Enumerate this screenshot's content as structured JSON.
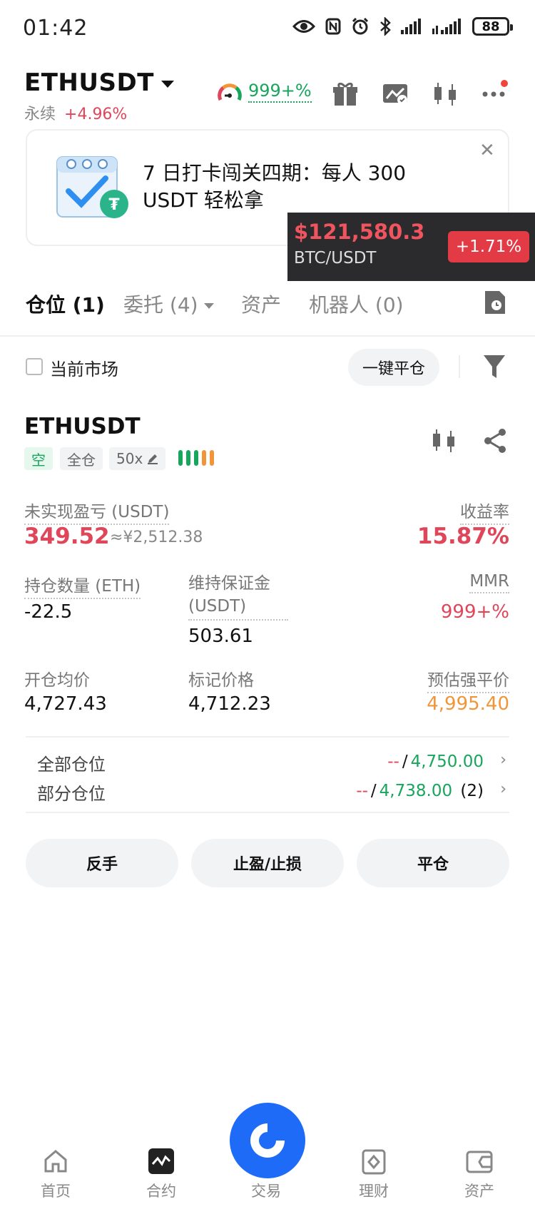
{
  "status_bar": {
    "time": "01:42",
    "battery": "88"
  },
  "header": {
    "symbol": "ETHUSDT",
    "contract_type": "永续",
    "change_pct": "+4.96%",
    "mmr_badge": "999+%"
  },
  "banner": {
    "text": "7 日打卡闯关四期：每人 300 USDT 轻松拿"
  },
  "price_popup": {
    "price": "$121,580.3",
    "pair": "BTC/USDT",
    "change": "+1.71%"
  },
  "tabs": [
    {
      "label": "仓位 (1)",
      "active": true
    },
    {
      "label": "委托 (4)",
      "active": false
    },
    {
      "label": "资产",
      "active": false
    },
    {
      "label": "机器人 (0)",
      "active": false
    }
  ],
  "filter": {
    "current_market_label": "当前市场",
    "close_all_label": "一键平仓"
  },
  "position": {
    "symbol": "ETHUSDT",
    "side": "空",
    "margin_mode": "全仓",
    "leverage": "50x",
    "unrealized_pnl_label": "未实现盈亏 (USDT)",
    "unrealized_pnl": "349.52",
    "unrealized_pnl_cny": "≈¥2,512.38",
    "roi_label": "收益率",
    "roi": "15.87%",
    "qty_label": "持仓数量 (ETH)",
    "qty": "-22.5",
    "maint_margin_label": "维持保证金 (USDT)",
    "maint_margin": "503.61",
    "mmr_label": "MMR",
    "mmr": "999+%",
    "entry_label": "开仓均价",
    "entry": "4,727.43",
    "mark_label": "标记价格",
    "mark": "4,712.23",
    "liq_label": "预估强平价",
    "liq": "4,995.40",
    "tpsl": [
      {
        "label": "全部仓位",
        "tp": "--",
        "sl": "4,750.00",
        "count": ""
      },
      {
        "label": "部分仓位",
        "tp": "--",
        "sl": "4,738.00",
        "count": "(2)"
      }
    ],
    "slash": "/",
    "actions": [
      "反手",
      "止盈/止损",
      "平仓"
    ]
  },
  "bottom_nav": [
    {
      "label": "首页",
      "icon": "home-icon"
    },
    {
      "label": "合约",
      "icon": "futures-icon"
    },
    {
      "label": "交易",
      "icon": "trade-icon"
    },
    {
      "label": "理财",
      "icon": "earn-icon"
    },
    {
      "label": "资产",
      "icon": "wallet-icon"
    }
  ],
  "colors": {
    "red": "#e0465a",
    "green": "#18a55c",
    "orange": "#f0953a",
    "blue": "#1e6bf7"
  }
}
